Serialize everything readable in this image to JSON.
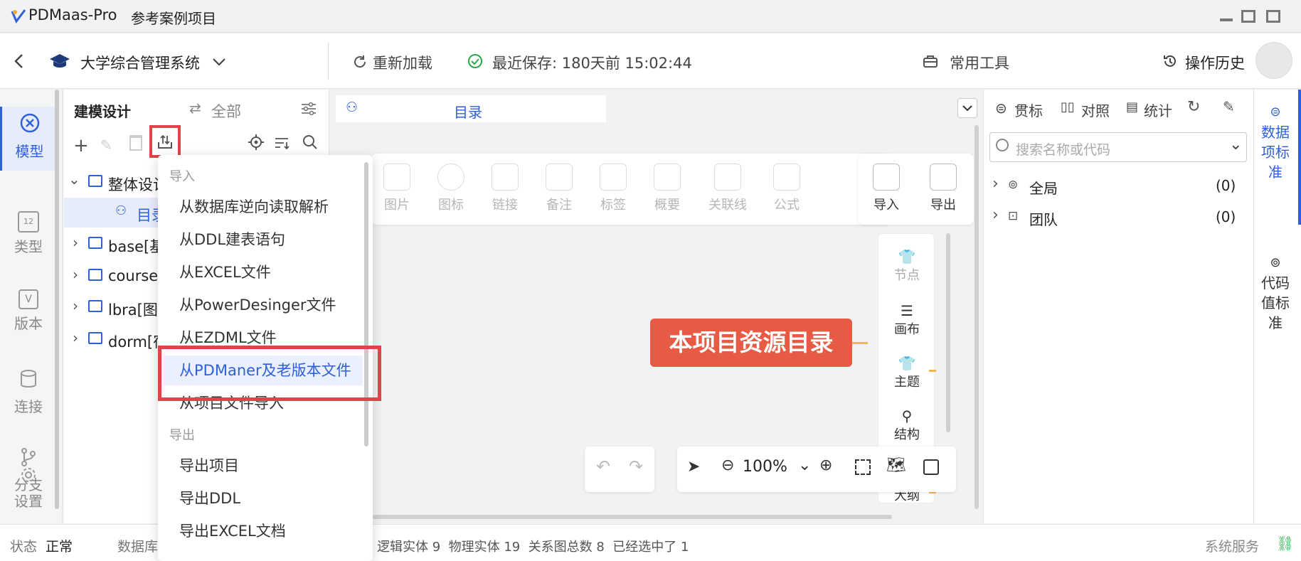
{
  "window": {
    "app_name": "PDMaas-Pro",
    "project": "参考案例项目"
  },
  "toolbar": {
    "project_title": "大学综合管理系统",
    "reload": "重新加载",
    "last_save": "最近保存: 180天前 15:02:44",
    "common_tools": "常用工具",
    "history": "操作历史"
  },
  "sidebar": {
    "items": [
      {
        "label": "模型",
        "icon": "cube-icon"
      },
      {
        "label": "类型",
        "icon": "type-icon"
      },
      {
        "label": "版本",
        "icon": "version-icon"
      },
      {
        "label": "连接",
        "icon": "database-icon"
      },
      {
        "label": "分支",
        "icon": "branch-icon"
      },
      {
        "label": "设置",
        "icon": "gear-icon"
      }
    ]
  },
  "tree": {
    "tab_modeling": "建模设计",
    "tab_all": "全部",
    "nodes": [
      "整体设计",
      "目录",
      "base[基",
      "course",
      "lbra[图",
      "dorm[宿"
    ]
  },
  "menu": {
    "import_header": "导入",
    "import_items": [
      "从数据库逆向读取解析",
      "从DDL建表语句",
      "从EXCEL文件",
      "从PowerDesinger文件",
      "从EZDML文件",
      "从PDManer及老版本文件",
      "从项目文件导入"
    ],
    "export_header": "导出",
    "export_items": [
      "导出项目",
      "导出DDL",
      "导出EXCEL文档"
    ]
  },
  "canvas": {
    "tab_label": "目录",
    "tools": [
      "图片",
      "图标",
      "链接",
      "备注",
      "标签",
      "概要",
      "关联线",
      "公式"
    ],
    "import_label": "导入",
    "export_label": "导出",
    "vertical_tools": [
      "节点",
      "画布",
      "主题",
      "结构",
      "大纲"
    ],
    "center_node": "本项目资源目录",
    "zoom": "100%"
  },
  "right": {
    "tabs": [
      "贯标",
      "对照",
      "统计"
    ],
    "search_placeholder": "搜索名称或代码",
    "rows": [
      {
        "name": "全局",
        "count": "(0)"
      },
      {
        "name": "团队",
        "count": "(0)"
      }
    ]
  },
  "farright": {
    "items": [
      "数据项标准",
      "代码值标准"
    ]
  },
  "status": {
    "state_label": "状态",
    "state_value": "正常",
    "db_label": "数据库",
    "stats": "逻辑实体 9  物理实体 19  关系图总数 8  已经选中了 1",
    "service": "系统服务"
  },
  "colors": {
    "accent": "#2f5fd9",
    "highlight_box": "#e4424a",
    "center_node": "#e75a43"
  }
}
